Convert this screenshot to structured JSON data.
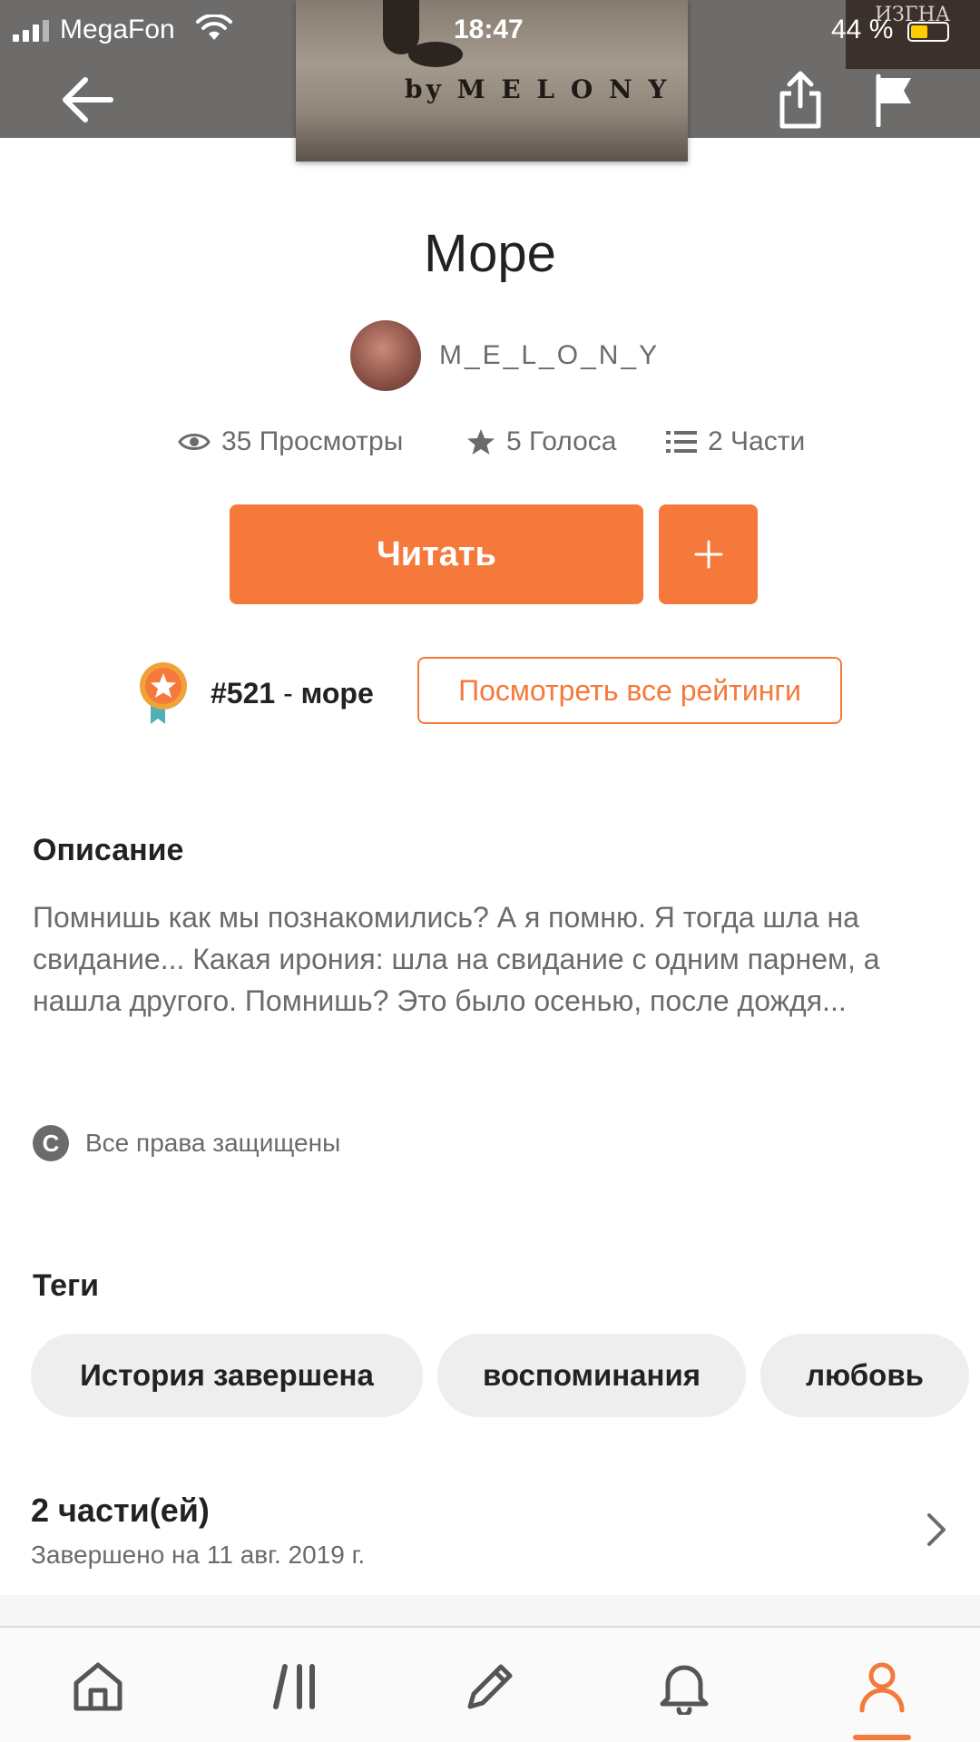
{
  "status_bar": {
    "carrier": "MegaFon",
    "time": "18:47",
    "battery": "44 %"
  },
  "header": {
    "cover_text": "by M E L O N Y",
    "corner_book_text": "ИЗГНА",
    "icons": [
      "back-arrow-icon",
      "share-icon",
      "flag-icon"
    ]
  },
  "story": {
    "title": "Море",
    "author": "M_E_L_O_N_Y",
    "views": "35 Просмотры",
    "votes": "5 Голоса",
    "parts": "2 Части"
  },
  "actions": {
    "read_label": "Читать",
    "add_label": "+"
  },
  "ranking": {
    "number": "#521",
    "separator": " - ",
    "tag": "море",
    "view_all": "Посмотреть все рейтинги"
  },
  "description": {
    "heading": "Описание",
    "text": "Помнишь как мы познакомились? А я помню. Я тогда шла на свидание... Какая ирония: шла на свидание с одним парнем, а нашла другого. Помнишь? Это было осенью, после дождя..."
  },
  "copyright": {
    "symbol": "C",
    "text": "Все права защищены"
  },
  "tags": {
    "heading": "Теги",
    "items": [
      "История завершена",
      "воспоминания",
      "любовь"
    ]
  },
  "parts_section": {
    "title": "2 части(ей)",
    "subtitle": "Завершено на 11 авг. 2019 г."
  },
  "tabbar": {
    "items": [
      "home-icon",
      "library-icon",
      "write-icon",
      "notifications-icon",
      "profile-icon"
    ],
    "active": "profile-icon"
  },
  "colors": {
    "accent": "#f5793b",
    "text": "#222222",
    "muted": "#6b6b6b",
    "tag_bg": "#eeeeee"
  }
}
